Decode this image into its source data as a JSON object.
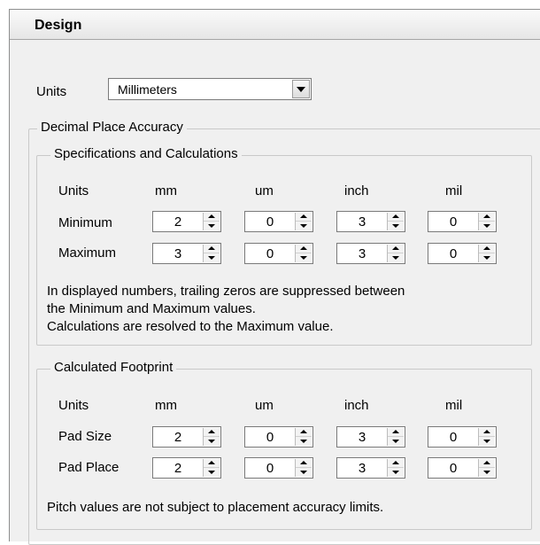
{
  "header": {
    "title": "Design"
  },
  "units": {
    "label": "Units",
    "value": "Millimeters"
  },
  "decimal_group": {
    "title": "Decimal Place Accuracy"
  },
  "specs": {
    "title": "Specifications and Calculations",
    "units_label": "Units",
    "columns": [
      "mm",
      "um",
      "inch",
      "mil"
    ],
    "rows": [
      {
        "label": "Minimum",
        "values": [
          "2",
          "0",
          "3",
          "0"
        ]
      },
      {
        "label": "Maximum",
        "values": [
          "3",
          "0",
          "3",
          "0"
        ]
      }
    ],
    "note_lines": [
      "In displayed numbers, trailing zeros are suppressed between",
      "the Minimum and Maximum values.",
      "Calculations are resolved to the Maximum value."
    ]
  },
  "footprint": {
    "title": "Calculated Footprint",
    "units_label": "Units",
    "columns": [
      "mm",
      "um",
      "inch",
      "mil"
    ],
    "rows": [
      {
        "label": "Pad Size",
        "values": [
          "2",
          "0",
          "3",
          "0"
        ]
      },
      {
        "label": "Pad Place",
        "values": [
          "2",
          "0",
          "3",
          "0"
        ]
      }
    ],
    "note": "Pitch values are not subject to placement accuracy limits."
  }
}
